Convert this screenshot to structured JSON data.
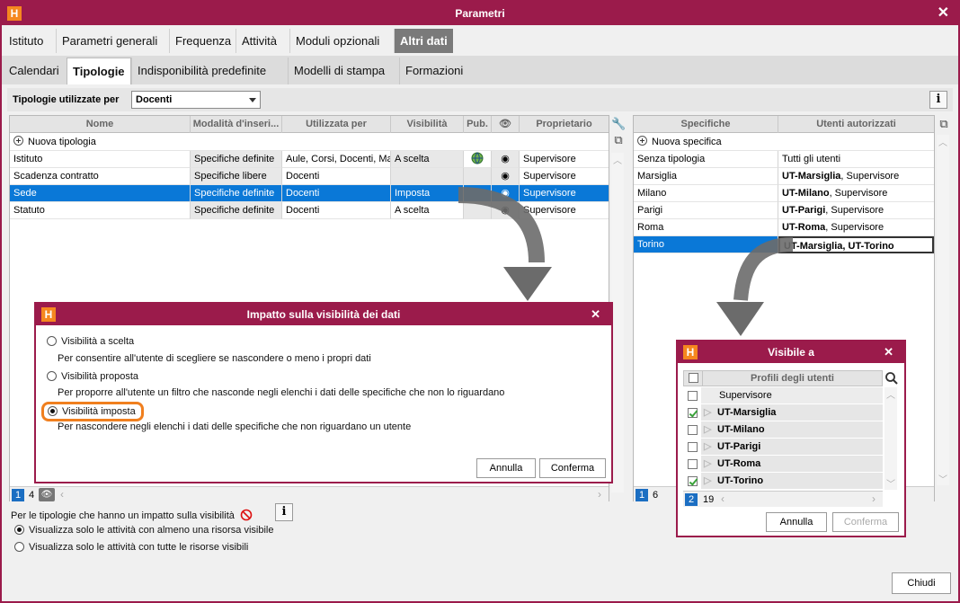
{
  "window": {
    "title": "Parametri",
    "logo": "H"
  },
  "tabs_main": [
    "Istituto",
    "Parametri generali",
    "Frequenza",
    "Attività",
    "Moduli opzionali",
    "Altri dati"
  ],
  "tabs_sub": [
    "Calendari",
    "Tipologie",
    "Indisponibilità predefinite",
    "Modelli di stampa",
    "Formazioni"
  ],
  "filter": {
    "label": "Tipologie utilizzate per",
    "value": "Docenti"
  },
  "left_table": {
    "headers": [
      "Nome",
      "Modalità d'inseri...",
      "Utilizzata per",
      "Visibilità",
      "Pub.",
      "Proprietario"
    ],
    "new_label": "Nuova tipologia",
    "rows": [
      {
        "nome": "Istituto",
        "modalita": "Specifiche definite",
        "utilizzata": "Aule, Corsi, Docenti, Ma",
        "visibilita": "A scelta",
        "pub": "globe",
        "prop": "Supervisore"
      },
      {
        "nome": "Scadenza contratto",
        "modalita": "Specifiche libere",
        "utilizzata": "Docenti",
        "visibilita": "",
        "pub": "",
        "prop": "Supervisore"
      },
      {
        "nome": "Sede",
        "modalita": "Specifiche definite",
        "utilizzata": "Docenti",
        "visibilita": "Imposta",
        "pub": "",
        "prop": "Supervisore"
      },
      {
        "nome": "Statuto",
        "modalita": "Specifiche definite",
        "utilizzata": "Docenti",
        "visibilita": "A scelta",
        "pub": "",
        "prop": "Supervisore"
      }
    ],
    "footer_page": "1",
    "footer_count": "4"
  },
  "right_table": {
    "headers": [
      "Specifiche",
      "Utenti autorizzati"
    ],
    "new_label": "Nuova specifica",
    "rows": [
      {
        "spec": "Senza tipologia",
        "bold": "",
        "rest": "Tutti gli utenti"
      },
      {
        "spec": "Marsiglia",
        "bold": "UT-Marsiglia",
        "rest": ", Supervisore"
      },
      {
        "spec": "Milano",
        "bold": "UT-Milano",
        "rest": ", Supervisore"
      },
      {
        "spec": "Parigi",
        "bold": "UT-Parigi",
        "rest": ", Supervisore"
      },
      {
        "spec": "Roma",
        "bold": "UT-Roma",
        "rest": ", Supervisore"
      },
      {
        "spec": "Torino",
        "bold": "UT-Marsiglia, UT-Torino",
        "rest": ""
      }
    ],
    "footer_page": "1",
    "footer_count": "6"
  },
  "bottom": {
    "note": "Per le tipologie che hanno un impatto sulla visibilità",
    "opt1": "Visualizza solo le attività con almeno una risorsa visibile",
    "opt2": "Visualizza solo le attività con tutte le risorse visibili",
    "close": "Chiudi"
  },
  "dialog_visibility": {
    "title": "Impatto sulla visibilità dei dati",
    "options": [
      {
        "label": "Visibilità a scelta",
        "desc": "Per consentire all'utente di scegliere se nascondere o meno i propri dati"
      },
      {
        "label": "Visibilità proposta",
        "desc": "Per proporre all'utente un filtro che nasconde negli elenchi i dati delle specifiche che non lo riguardano"
      },
      {
        "label": "Visibilità imposta",
        "desc": "Per nascondere negli elenchi i dati delle specifiche che non riguardano un utente"
      }
    ],
    "cancel": "Annulla",
    "confirm": "Conferma"
  },
  "dialog_visible": {
    "title": "Visibile a",
    "header": "Profili degli utenti",
    "items": [
      {
        "label": "Supervisore",
        "checked": false
      },
      {
        "label": "UT-Marsiglia",
        "checked": true
      },
      {
        "label": "UT-Milano",
        "checked": false
      },
      {
        "label": "UT-Parigi",
        "checked": false
      },
      {
        "label": "UT-Roma",
        "checked": false
      },
      {
        "label": "UT-Torino",
        "checked": true
      }
    ],
    "footer_page": "2",
    "footer_count": "19",
    "cancel": "Annulla",
    "confirm": "Conferma"
  },
  "colors": {
    "brand": "#9b1b4b",
    "selection": "#0a78d7",
    "highlight": "#f07f1e",
    "logo": "#f5871f"
  }
}
